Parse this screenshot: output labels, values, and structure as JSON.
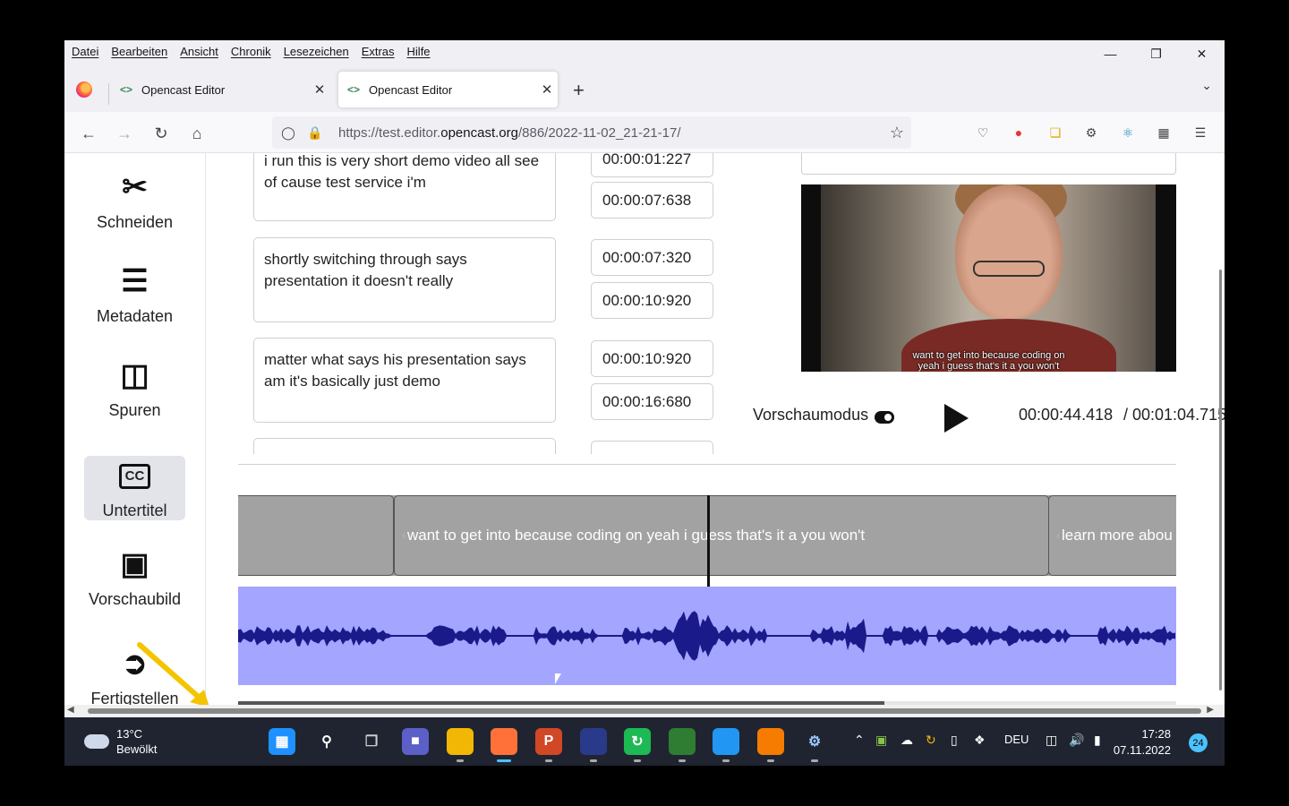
{
  "menu": [
    "Datei",
    "Bearbeiten",
    "Ansicht",
    "Chronik",
    "Lesezeichen",
    "Extras",
    "Hilfe"
  ],
  "tabs": [
    {
      "label": "Opencast Editor"
    },
    {
      "label": "Opencast Editor"
    }
  ],
  "url": {
    "prefix": "https://test.editor.",
    "domain": "opencast.org",
    "path": "/886/2022-11-02_21-21-17/"
  },
  "sidebar": {
    "items": [
      {
        "label": "Schneiden",
        "icon": "scissors-icon"
      },
      {
        "label": "Metadaten",
        "icon": "list-icon"
      },
      {
        "label": "Spuren",
        "icon": "film-icon"
      },
      {
        "label": "Untertitel",
        "icon": "cc-icon"
      },
      {
        "label": "Vorschaubild",
        "icon": "images-icon"
      },
      {
        "label": "Fertigstellen",
        "icon": "sign-out-icon"
      }
    ],
    "cc_text": "CC",
    "active": "Untertitel"
  },
  "subtitles": [
    {
      "text": "i run this is very short demo video all see of cause test service i'm",
      "start": "00:00:01:227",
      "end": "00:00:07:638"
    },
    {
      "text": "shortly switching through says presentation it doesn't really",
      "start": "00:00:07:320",
      "end": "00:00:10:920"
    },
    {
      "text": "matter what says his presentation says am it's basically just demo",
      "start": "00:00:10:920",
      "end": "00:00:16:680"
    }
  ],
  "video": {
    "caption_line1": "want to get into because coding on",
    "caption_line2": "yeah i guess that's it a you won't"
  },
  "player": {
    "preview_mode_label": "Vorschaumodus",
    "current_time": "00:00:44.418",
    "total_time": "/ 00:01:04.715"
  },
  "timeline": {
    "segments": [
      {
        "text": ""
      },
      {
        "text": "want to get into because coding on yeah i guess that's it a you won't"
      },
      {
        "text": "learn more abou"
      }
    ]
  },
  "taskbar": {
    "temperature": "13°C",
    "weather": "Bewölkt",
    "language": "DEU",
    "time": "17:28",
    "date": "07.11.2022",
    "notifications": "24"
  },
  "colors": {
    "waveform_bg": "#a3a5ff",
    "waveform_fg": "#1a1a8a",
    "annotation_arrow": "#f5c400",
    "taskbar_bg": "#1f2430"
  }
}
